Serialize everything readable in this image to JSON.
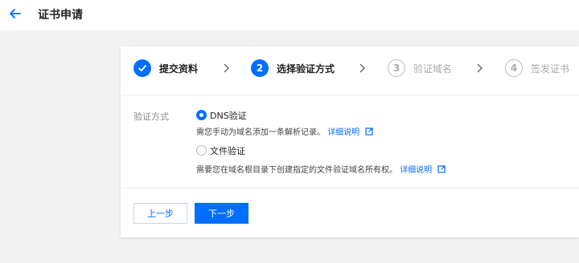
{
  "header": {
    "title": "证书申请"
  },
  "steps": [
    {
      "number": "1",
      "label": "提交资料",
      "status": "done"
    },
    {
      "number": "2",
      "label": "选择验证方式",
      "status": "active"
    },
    {
      "number": "3",
      "label": "验证域名",
      "status": "pending"
    },
    {
      "number": "4",
      "label": "签发证书",
      "status": "pending"
    }
  ],
  "form": {
    "label": "验证方式",
    "options": [
      {
        "label": "DNS验证",
        "selected": true,
        "description": "需您手动为域名添加一条解析记录。",
        "link": "详细说明"
      },
      {
        "label": "文件验证",
        "selected": false,
        "description": "需要您在域名根目录下创建指定的文件验证域名所有权。",
        "link": "详细说明"
      }
    ]
  },
  "buttons": {
    "prev": "上一步",
    "next": "下一步"
  },
  "colors": {
    "accent": "#006eff",
    "background": "#f2f2f2"
  }
}
